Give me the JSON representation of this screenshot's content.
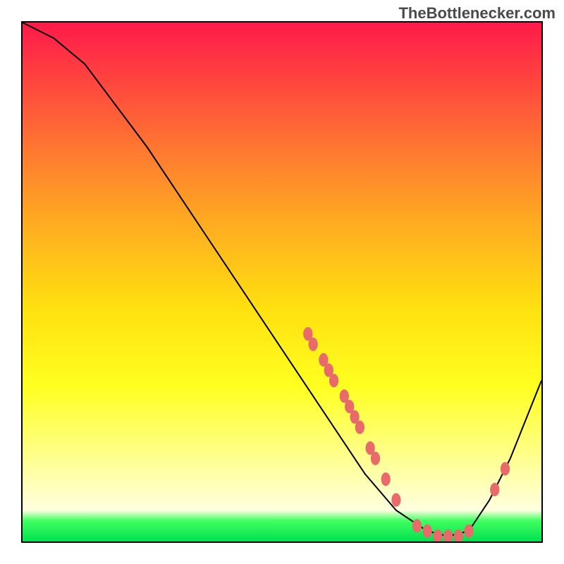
{
  "watermark": "TheBottlenecker.com",
  "chart_data": {
    "type": "line",
    "title": "",
    "xlabel": "",
    "ylabel": "",
    "xlim": [
      0,
      100
    ],
    "ylim": [
      0,
      100
    ],
    "curve": [
      {
        "x": 0,
        "y": 100
      },
      {
        "x": 6,
        "y": 97
      },
      {
        "x": 12,
        "y": 92
      },
      {
        "x": 18,
        "y": 84
      },
      {
        "x": 24,
        "y": 76
      },
      {
        "x": 30,
        "y": 67
      },
      {
        "x": 36,
        "y": 58
      },
      {
        "x": 42,
        "y": 49
      },
      {
        "x": 48,
        "y": 40
      },
      {
        "x": 54,
        "y": 31
      },
      {
        "x": 60,
        "y": 22
      },
      {
        "x": 66,
        "y": 13
      },
      {
        "x": 72,
        "y": 6
      },
      {
        "x": 78,
        "y": 2
      },
      {
        "x": 82,
        "y": 1
      },
      {
        "x": 86,
        "y": 2
      },
      {
        "x": 90,
        "y": 8
      },
      {
        "x": 94,
        "y": 16
      },
      {
        "x": 98,
        "y": 26
      },
      {
        "x": 100,
        "y": 31
      }
    ],
    "markers": [
      {
        "x": 55,
        "y": 40
      },
      {
        "x": 56,
        "y": 38
      },
      {
        "x": 58,
        "y": 35
      },
      {
        "x": 59,
        "y": 33
      },
      {
        "x": 60,
        "y": 31
      },
      {
        "x": 62,
        "y": 28
      },
      {
        "x": 63,
        "y": 26
      },
      {
        "x": 64,
        "y": 24
      },
      {
        "x": 65,
        "y": 22
      },
      {
        "x": 67,
        "y": 18
      },
      {
        "x": 68,
        "y": 16
      },
      {
        "x": 70,
        "y": 12
      },
      {
        "x": 72,
        "y": 8
      },
      {
        "x": 76,
        "y": 3
      },
      {
        "x": 78,
        "y": 2
      },
      {
        "x": 80,
        "y": 1
      },
      {
        "x": 82,
        "y": 1
      },
      {
        "x": 84,
        "y": 1
      },
      {
        "x": 86,
        "y": 2
      },
      {
        "x": 91,
        "y": 10
      },
      {
        "x": 93,
        "y": 14
      }
    ],
    "marker_color": "#e86a6a",
    "curve_color": "#000000"
  }
}
